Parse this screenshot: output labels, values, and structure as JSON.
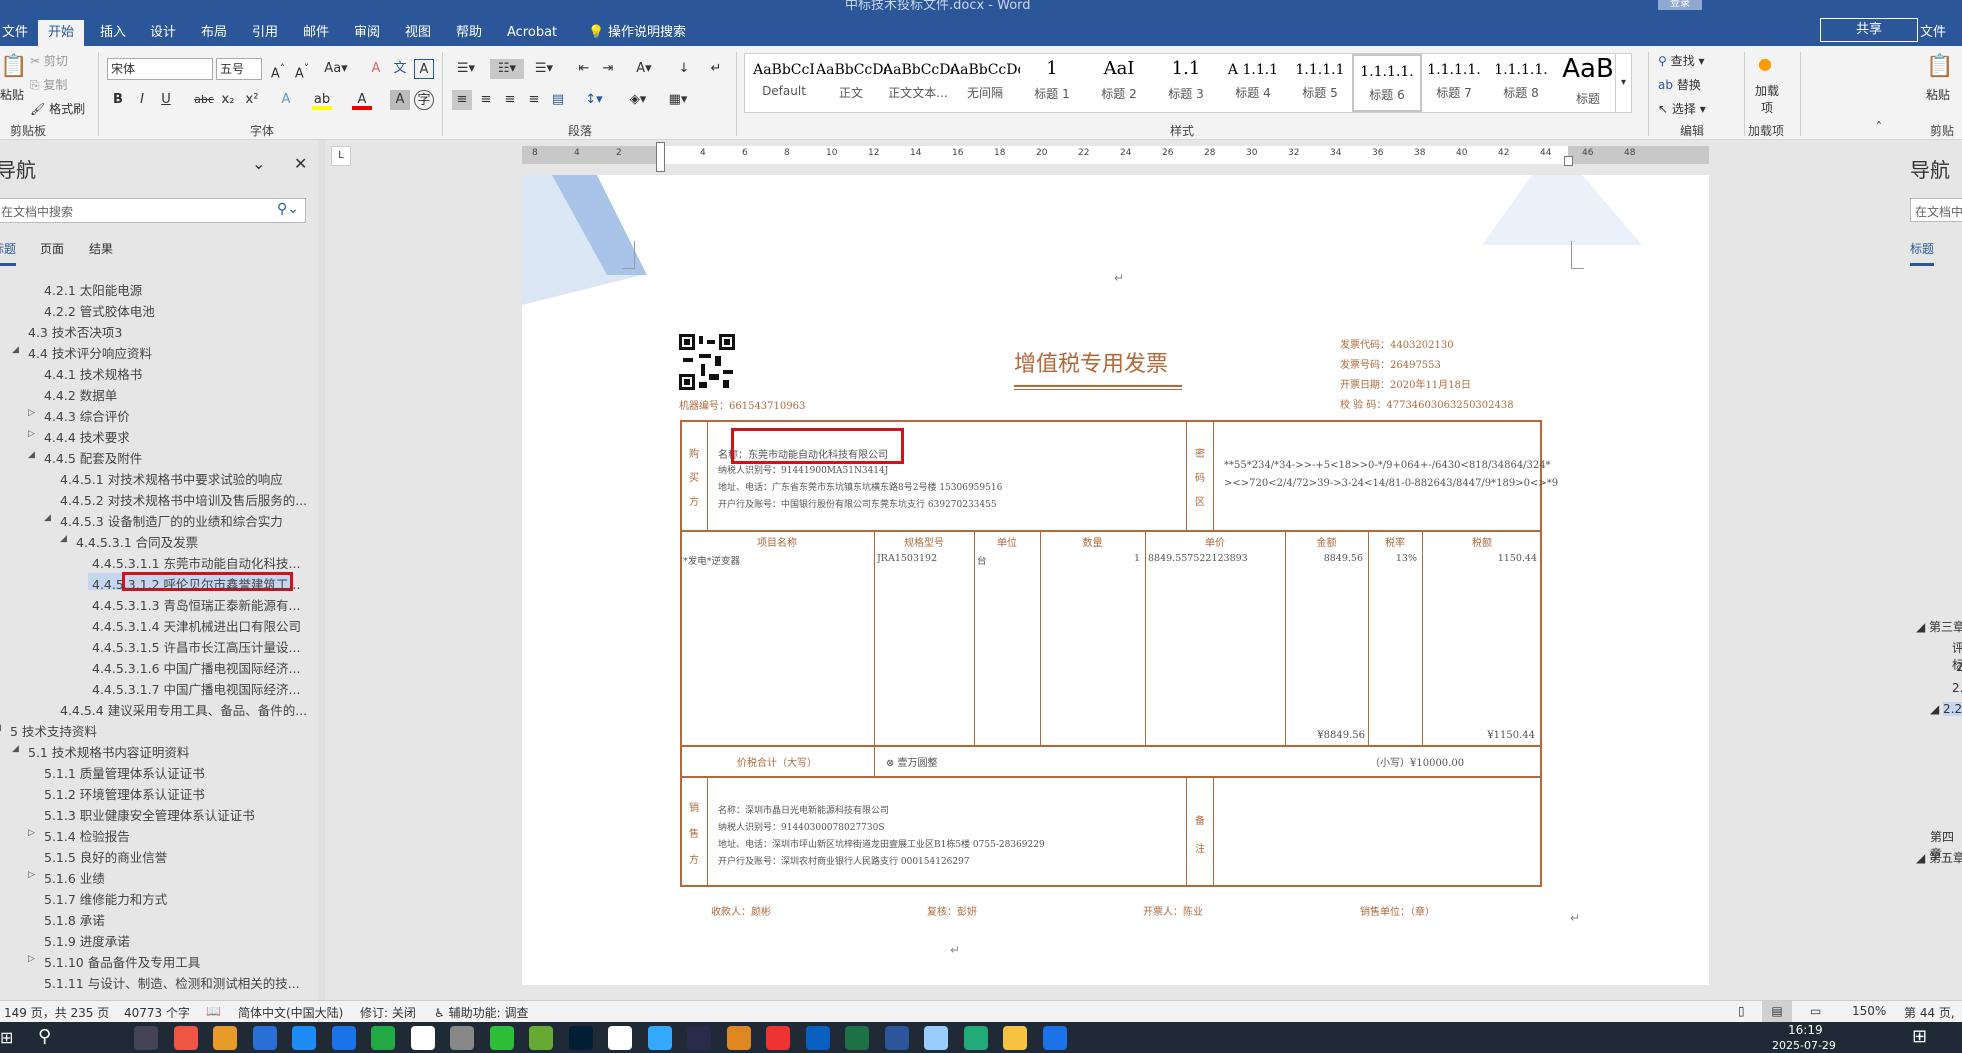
{
  "window": {
    "title": "中标技术投标文件.docx - Word",
    "signin": "登录"
  },
  "tabs": [
    "文件",
    "开始",
    "插入",
    "设计",
    "布局",
    "引用",
    "邮件",
    "审阅",
    "视图",
    "帮助",
    "Acrobat"
  ],
  "tell_me": "操作说明搜索",
  "share": "共享",
  "right_tab": "文件",
  "ribbon": {
    "clipboard": {
      "paste": "粘贴",
      "cut": "剪切",
      "copy": "复制",
      "format_painter": "格式刷",
      "label": "剪贴板"
    },
    "font": {
      "name": "宋体",
      "size": "五号",
      "label": "字体"
    },
    "paragraph": {
      "label": "段落"
    },
    "styles": {
      "label": "样式",
      "items": [
        {
          "preview": "AaBbCcI",
          "name": "Default"
        },
        {
          "preview": "AaBbCcDdI",
          "name": "正文"
        },
        {
          "preview": "AaBbCcDdI",
          "name": "正文文本..."
        },
        {
          "preview": "AaBbCcDdI",
          "name": "无间隔"
        },
        {
          "preview": "1",
          "name": "标题 1"
        },
        {
          "preview": "AaI",
          "name": "标题 2"
        },
        {
          "preview": "1.1",
          "name": "标题 3"
        },
        {
          "preview": "A 1.1.1",
          "name": "标题 4"
        },
        {
          "preview": "1.1.1.1",
          "name": "标题 5"
        },
        {
          "preview": "1.1.1.1.",
          "name": "标题 6"
        },
        {
          "preview": "1.1.1.1.",
          "name": "标题 7"
        },
        {
          "preview": "1.1.1.1.",
          "name": "标题 8"
        },
        {
          "preview": "AaB",
          "name": "标题"
        }
      ],
      "selected": "标题 6"
    },
    "editing": {
      "find": "查找",
      "replace": "替换",
      "select": "选择",
      "label": "编辑"
    },
    "addins": {
      "addins": "加载项",
      "label": "加载项"
    },
    "right_clipboard": {
      "paste": "粘贴",
      "label": "剪贴板"
    }
  },
  "nav": {
    "title": "导航",
    "search_placeholder": "在文档中搜索",
    "tabs": [
      "标题",
      "页面",
      "结果"
    ],
    "items": [
      {
        "t": "4.2.1 太阳能电源",
        "lvl": 2,
        "exp": ""
      },
      {
        "t": "4.2.2 管式胶体电池",
        "lvl": 2,
        "exp": ""
      },
      {
        "t": "4.3 技术否决项3",
        "lvl": 1,
        "exp": ""
      },
      {
        "t": "4.4 技术评分响应资料",
        "lvl": 1,
        "exp": "open"
      },
      {
        "t": "4.4.1 技术规格书",
        "lvl": 2,
        "exp": ""
      },
      {
        "t": "4.4.2 数据单",
        "lvl": 2,
        "exp": ""
      },
      {
        "t": "4.4.3 综合评价",
        "lvl": 2,
        "exp": "closed"
      },
      {
        "t": "4.4.4 技术要求",
        "lvl": 2,
        "exp": "closed"
      },
      {
        "t": "4.4.5 配套及附件",
        "lvl": 2,
        "exp": "open"
      },
      {
        "t": "4.4.5.1 对技术规格书中要求试验的响应",
        "lvl": 3,
        "exp": ""
      },
      {
        "t": "4.4.5.2 对技术规格书中培训及售后服务的...",
        "lvl": 3,
        "exp": ""
      },
      {
        "t": "4.4.5.3 设备制造厂的的业绩和综合实力",
        "lvl": 3,
        "exp": "open"
      },
      {
        "t": "4.4.5.3.1 合同及发票",
        "lvl": 4,
        "exp": "open"
      },
      {
        "t": "4.4.5.3.1.1 东莞市动能自动化科技...",
        "lvl": 5,
        "exp": ""
      },
      {
        "t": "4.4.5.3.1.2 呼伦贝尔市鑫誉建筑工...",
        "lvl": 5,
        "exp": "",
        "sel": true
      },
      {
        "t": "4.4.5.3.1.3 青岛恒瑞正泰新能源有...",
        "lvl": 5,
        "exp": ""
      },
      {
        "t": "4.4.5.3.1.4 天津机械进出口有限公司",
        "lvl": 5,
        "exp": ""
      },
      {
        "t": "4.4.5.3.1.5 许昌市长江高压计量设...",
        "lvl": 5,
        "exp": ""
      },
      {
        "t": "4.4.5.3.1.6 中国广播电视国际经济...",
        "lvl": 5,
        "exp": ""
      },
      {
        "t": "4.4.5.3.1.7 中国广播电视国际经济...",
        "lvl": 5,
        "exp": ""
      },
      {
        "t": "4.4.5.4 建议采用专用工具、备品、备件的...",
        "lvl": 3,
        "exp": ""
      },
      {
        "t": "5 技术支持资料",
        "lvl": 0,
        "exp": "open"
      },
      {
        "t": "5.1 技术规格书内容证明资料",
        "lvl": 1,
        "exp": "open"
      },
      {
        "t": "5.1.1 质量管理体系认证证书",
        "lvl": 2,
        "exp": ""
      },
      {
        "t": "5.1.2 环境管理体系认证证书",
        "lvl": 2,
        "exp": ""
      },
      {
        "t": "5.1.3 职业健康安全管理体系认证证书",
        "lvl": 2,
        "exp": ""
      },
      {
        "t": "5.1.4 检验报告",
        "lvl": 2,
        "exp": "closed"
      },
      {
        "t": "5.1.5 良好的商业信誉",
        "lvl": 2,
        "exp": ""
      },
      {
        "t": "5.1.6 业绩",
        "lvl": 2,
        "exp": "closed"
      },
      {
        "t": "5.1.7 维修能力和方式",
        "lvl": 2,
        "exp": ""
      },
      {
        "t": "5.1.8 承诺",
        "lvl": 2,
        "exp": ""
      },
      {
        "t": "5.1.9 进度承诺",
        "lvl": 2,
        "exp": ""
      },
      {
        "t": "5.1.10 备品备件及专用工具",
        "lvl": 2,
        "exp": "closed"
      },
      {
        "t": "5.1.11 与设计、制造、检测和测试相关的技...",
        "lvl": 2,
        "exp": ""
      }
    ]
  },
  "right_nav": {
    "title": "导航",
    "search_placeholder": "在文档中",
    "tab": "标题",
    "items": [
      "第三章",
      "评标",
      "2.",
      "2.2",
      "2.2",
      "第四章",
      "第五章"
    ]
  },
  "ruler": {
    "ticks": [
      "8",
      "4",
      "2",
      "2",
      "4",
      "6",
      "8",
      "10",
      "12",
      "14",
      "16",
      "18",
      "20",
      "22",
      "24",
      "26",
      "28",
      "30",
      "32",
      "34",
      "36",
      "38",
      "40",
      "42",
      "44",
      "46",
      "48"
    ]
  },
  "invoice": {
    "title": "增值税专用发票",
    "machine_no": "机器编号：661543710963",
    "code": "发票代码：4403202130",
    "number": "发票号码：26497553",
    "date": "开票日期：2020年11月18日",
    "check": "校 验 码：47734603063250302438",
    "buyer_label": [
      "购",
      "买",
      "方"
    ],
    "buyer": [
      "名称：东莞市动能自动化科技有限公司",
      "纳税人识别号：91441900MA51N3414J",
      "地址、电话：广东省东莞市东坑镇东坑横东路8号2号楼 15306959516",
      "开户行及账号：中国银行股份有限公司东莞东坑支行 639270233455"
    ],
    "cipher_label": [
      "密",
      "码",
      "区"
    ],
    "cipher": [
      "**55*234/*34->>-+5<18>>0-*/9+064+-/6430<818/34864/324*",
      "><>720<2/4/72>39->3-24<14/81-0-882643/8447/9*189>0<>*9"
    ],
    "headers": [
      "项目名称",
      "规格型号",
      "单位",
      "数量",
      "单价",
      "金额",
      "税率",
      "税额"
    ],
    "row": [
      "*发电*逆变器",
      "JRA1503192",
      "台",
      "1",
      "8849.557522123893",
      "8849.56",
      "13%",
      "1150.44"
    ],
    "sum_amount": "¥8849.56",
    "sum_tax": "¥1150.44",
    "total_label": "价税合计（大写）",
    "total_words": "⊗ 壹万圆整",
    "total_small": "（小写）¥10000.00",
    "seller_label": [
      "销",
      "售",
      "方"
    ],
    "seller": [
      "名称：深圳市晶日光电新能源科技有限公司",
      "纳税人识别号：91440300078027730S",
      "地址、电话：深圳市坪山新区坑梓街道龙田壹展工业区B1栋5楼 0755-28369229",
      "开户行及账号：深圳农村商业银行人民路支行 000154126297"
    ],
    "remark_label": [
      "备",
      "注"
    ],
    "payee": "收款人：颜彬",
    "reviewer": "复核：彭妍",
    "drawer": "开票人：陈业",
    "seller_stamp": "销售单位：（章）"
  },
  "status": {
    "page": "149 页，共 235 页",
    "words": "40773 个字",
    "lang": "简体中文(中国大陆)",
    "revision": "修订: 关闭",
    "access": "辅助功能: 调查",
    "zoom": "150%",
    "page_right": "第 44 页,"
  },
  "taskbar": {
    "time": "16:19",
    "date": "2025-07-29"
  },
  "colors": {
    "accent": "#2b579a",
    "invoice": "#b5683a",
    "highlight": "#d0121b"
  }
}
